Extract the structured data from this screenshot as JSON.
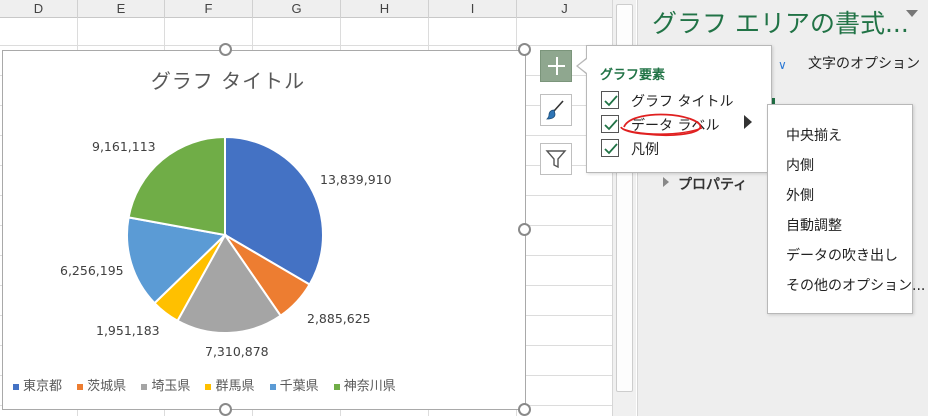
{
  "sheet": {
    "columns": [
      "D",
      "E",
      "F",
      "G",
      "H",
      "I",
      "J"
    ]
  },
  "chart": {
    "title": "グラフ タイトル",
    "chart_data": {
      "type": "pie",
      "categories": [
        "東京都",
        "茨城県",
        "埼玉県",
        "群馬県",
        "千葉県",
        "神奈川県"
      ],
      "values": [
        13839910,
        2885625,
        7310878,
        1951183,
        6256195,
        9161113
      ],
      "value_labels": [
        "13,839,910",
        "2,885,625",
        "7,310,878",
        "1,951,183",
        "6,256,195",
        "9,161,113"
      ],
      "colors": [
        "#4472c4",
        "#ed7d31",
        "#a5a5a5",
        "#ffc000",
        "#5b9bd5",
        "#70ad47"
      ],
      "title": "グラフ タイトル",
      "legend": "bottom"
    }
  },
  "side_buttons": {
    "elements_icon": "plus-icon",
    "styles_icon": "brush-icon",
    "filter_icon": "filter-icon"
  },
  "popup": {
    "title": "グラフ要素",
    "items": [
      {
        "label": "グラフ タイトル",
        "checked": true
      },
      {
        "label": "データ ラベル",
        "checked": true
      },
      {
        "label": "凡例",
        "checked": true
      }
    ]
  },
  "submenu": {
    "items": [
      "中央揃え",
      "内側",
      "外側",
      "自動調整",
      "データの吹き出し",
      "その他のオプション..."
    ]
  },
  "pane": {
    "title": "グラフ エリアの書式...",
    "tab_label": "文字のオプション",
    "section_label": "プロパティ"
  }
}
